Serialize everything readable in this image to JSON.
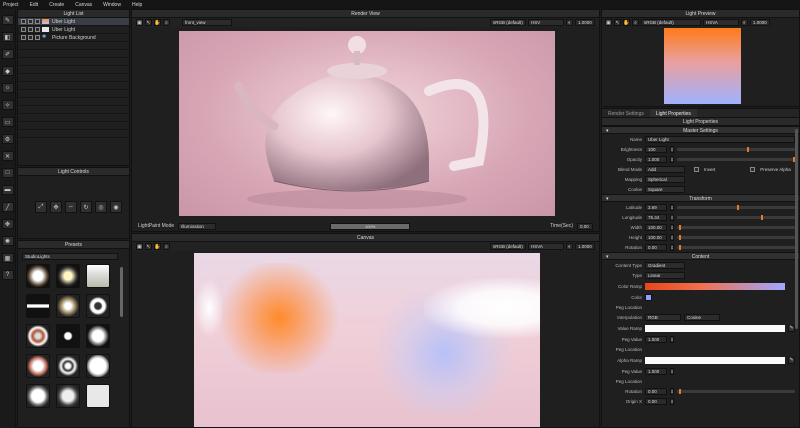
{
  "menu": [
    "Project",
    "Edit",
    "Create",
    "Canvas",
    "Window",
    "Help"
  ],
  "light_list": {
    "title": "Light List",
    "items": [
      {
        "name": "Uber Light",
        "selected": true
      },
      {
        "name": "Uber Light",
        "selected": false
      },
      {
        "name": "Picture Background",
        "selected": false
      }
    ]
  },
  "light_controls": {
    "title": "Light Controls"
  },
  "presets": {
    "title": "Presets",
    "category": "StudioLights"
  },
  "render_view": {
    "title": "Render View",
    "camera": "front_view",
    "color_space": "sRGB (default)",
    "color_mode": "HSV",
    "zoom": "1.0000",
    "mode_label": "LightPaint Mode",
    "mode_value": "Illumination",
    "progress": "100%",
    "progress_value": 1.0,
    "time_label": "Time(Sec)",
    "time_value": "0.00"
  },
  "canvas": {
    "title": "Canvas",
    "color_space": "sRGB (default)",
    "color_mode": "HSVA",
    "zoom": "1.0000"
  },
  "light_preview": {
    "title": "Light Preview",
    "color_space": "sRGB (default)",
    "color_mode": "HSVA",
    "zoom": "1.0000"
  },
  "tabs": [
    "Render Settings",
    "Light Properties"
  ],
  "props": {
    "title": "Light Properties",
    "master": "Master Settings",
    "name_label": "Name",
    "name": "Uber Light",
    "brightness_label": "Brightness",
    "brightness": "100",
    "opacity_label": "Opacity",
    "opacity": "1.000",
    "blend_label": "Blend Mode",
    "blend": "Add",
    "invert": "Invert",
    "preserve_alpha": "Preserve Alpha",
    "mapping_label": "Mapping",
    "mapping": "Spherical",
    "cookie_label": "Cookie",
    "cookie": "Square",
    "transform": "Transform",
    "lat_label": "Latitude",
    "lat": "3.69",
    "lon_label": "Longitude",
    "lon": "76.34",
    "width_label": "Width",
    "width": "100.00",
    "height_label": "Height",
    "height": "100.00",
    "rot_label": "Rotation",
    "rot": "0.00",
    "content": "Content",
    "ctype_label": "Content Type",
    "ctype": "Gradient",
    "type_label": "Type",
    "type": "Linear",
    "ramp_label": "Color Ramp",
    "color_label": "Color",
    "peg_loc_label": "Peg Location",
    "interp_label": "Interpolation",
    "interp1": "RGB",
    "interp2": "Cosine",
    "vramp_label": "Value Ramp",
    "peg_value_label": "Peg Value",
    "peg_value": "1.000",
    "peg_loc2_label": "Peg Location",
    "aramp_label": "Alpha Ramp",
    "peg_value2_label": "Peg Value",
    "peg_value2": "1.000",
    "peg_loc3_label": "Peg Location",
    "rot2_label": "Rotation",
    "rot2": "0.00",
    "originx_label": "Origin X",
    "originx": "0.00"
  },
  "colors": {
    "accent": "#e07a2a",
    "panel": "#1f1f1f",
    "title": "#2a2a2a"
  }
}
